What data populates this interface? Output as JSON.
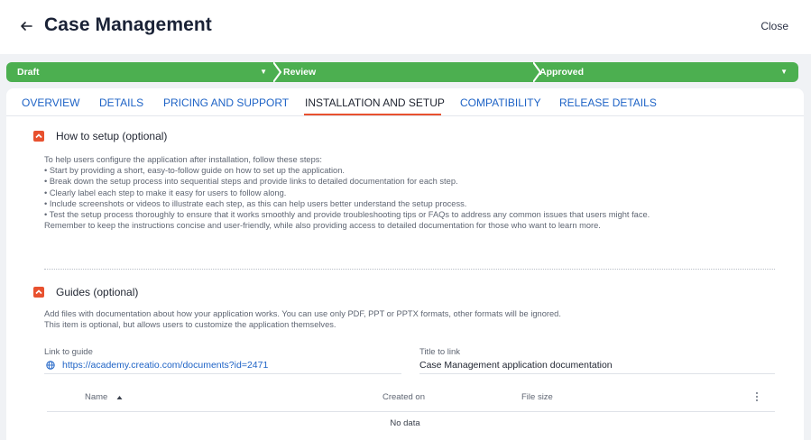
{
  "header": {
    "title": "Case Management",
    "close_label": "Close"
  },
  "stages": [
    {
      "label": "Draft"
    },
    {
      "label": "Review"
    },
    {
      "label": "Approved"
    }
  ],
  "colors": {
    "stage_green": "#4caf50",
    "tab_blue": "#1e63c6",
    "accent_orange": "#e8512f"
  },
  "tabs": [
    {
      "label": "OVERVIEW"
    },
    {
      "label": "DETAILS"
    },
    {
      "label": "PRICING AND SUPPORT"
    },
    {
      "label": "INSTALLATION AND SETUP",
      "active": true
    },
    {
      "label": "COMPATIBILITY"
    },
    {
      "label": "RELEASE DETAILS"
    }
  ],
  "setup_section": {
    "title": "How to setup (optional)",
    "description": "To help users configure the application after installation, follow these steps:\n• Start by providing a short, easy-to-follow guide on how to set up the application.\n• Break down the setup process into sequential steps and provide links to detailed documentation for each step.\n• Clearly label each step to make it easy for users to follow along.\n• Include screenshots or videos to illustrate each step, as this can help users better understand the setup process.\n• Test the setup process thoroughly to ensure that it works smoothly and provide troubleshooting tips or FAQs to address any common issues that users might face.\nRemember to keep the instructions concise and user-friendly, while also providing access to detailed documentation for those who want to learn more."
  },
  "guides_section": {
    "title": "Guides (optional)",
    "description": "Add files with documentation about how your application works. You can use only PDF, PPT or PPTX formats, other formats will be ignored.\nThis item is optional, but allows users to customize the application themselves.",
    "link_label": "Link to guide",
    "link_value": "https://academy.creatio.com/documents?id=2471",
    "title_label": "Title to link",
    "title_value": "Case Management application documentation",
    "table": {
      "columns": [
        "Name",
        "Created on",
        "File size"
      ],
      "empty_text": "No data"
    }
  }
}
